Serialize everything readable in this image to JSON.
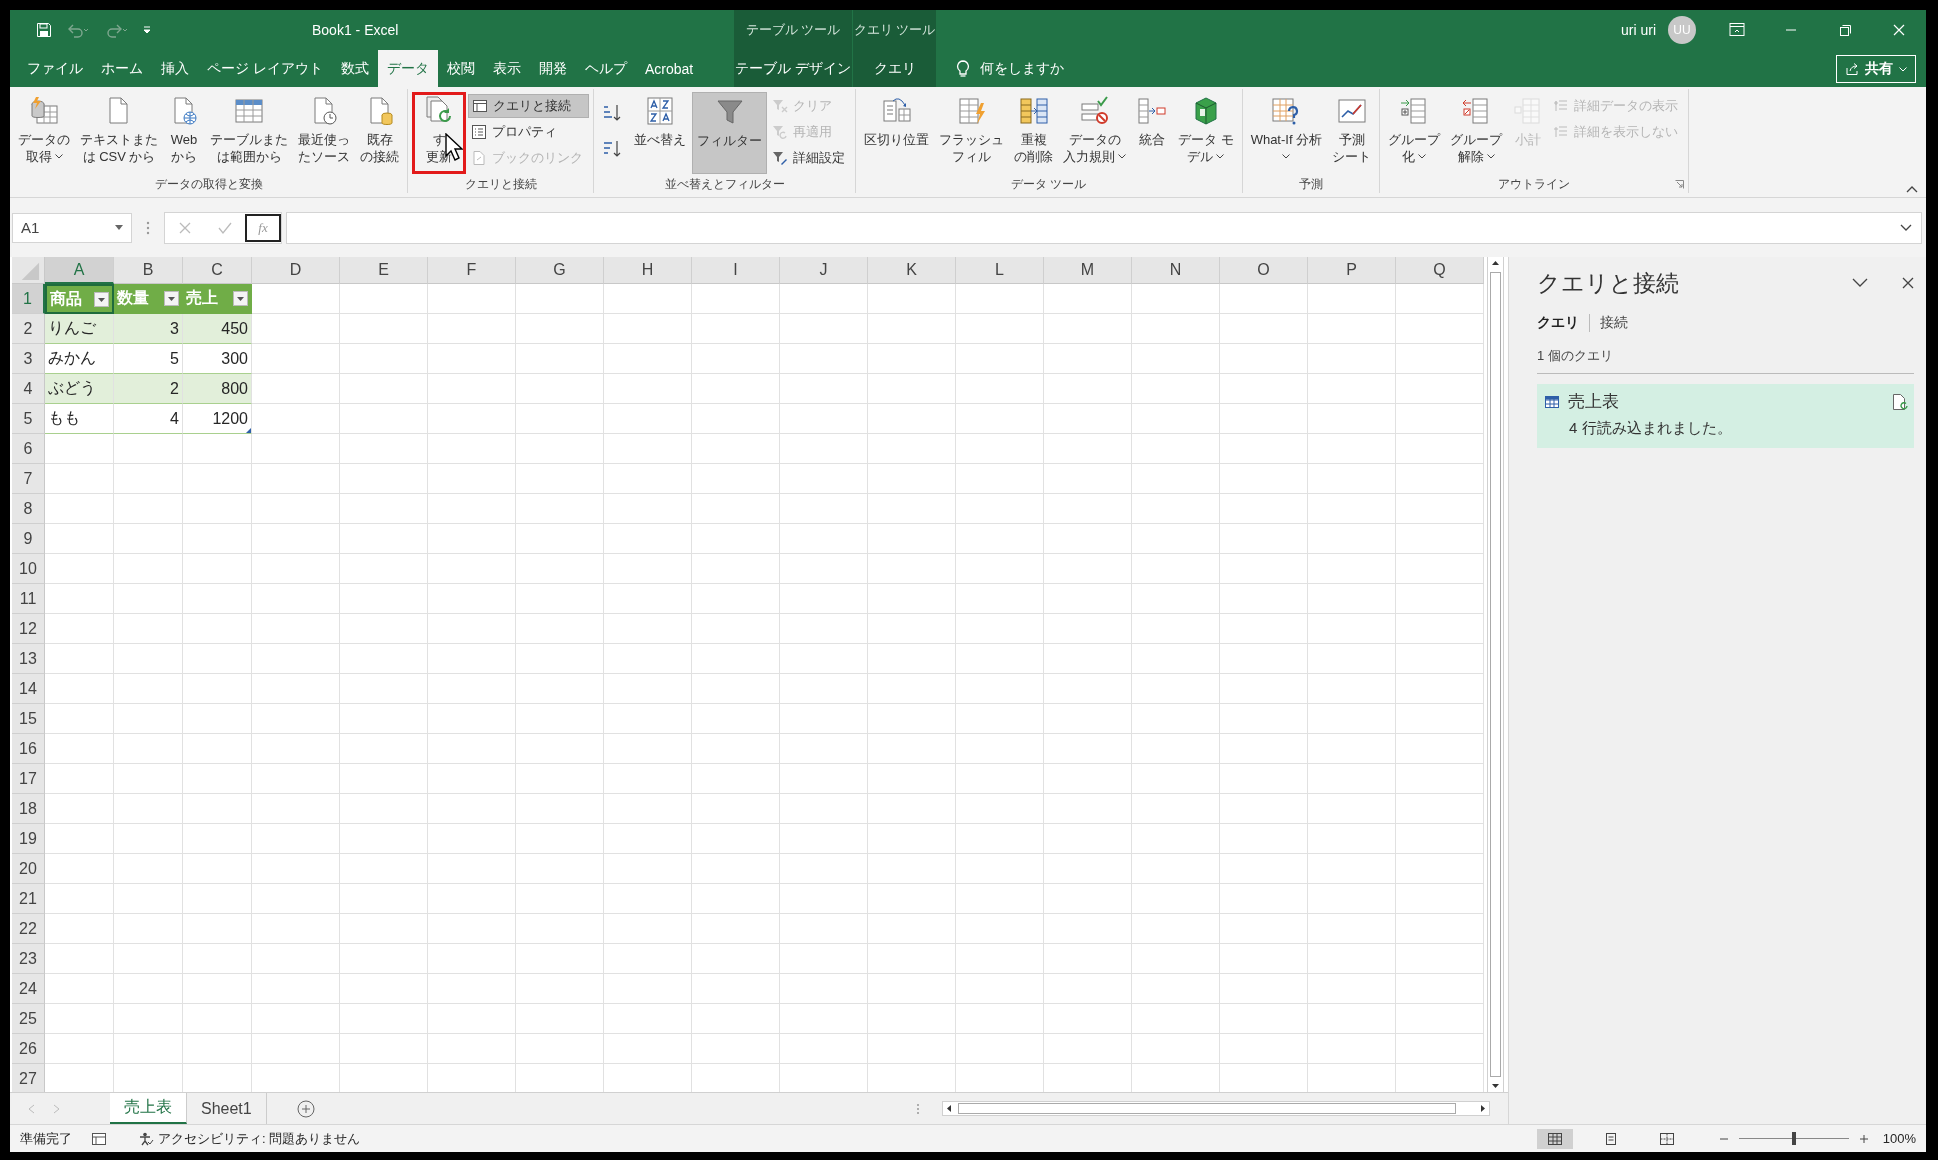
{
  "title_bar": {
    "title": "Book1  -  Excel",
    "context_labels": [
      "テーブル ツール",
      "クエリ ツール"
    ],
    "user": "uri uri",
    "avatar": "UU"
  },
  "ribbon_tabs": [
    {
      "label": "ファイル",
      "selected": false,
      "kind": "normal"
    },
    {
      "label": "ホーム",
      "selected": false,
      "kind": "normal"
    },
    {
      "label": "挿入",
      "selected": false,
      "kind": "normal"
    },
    {
      "label": "ページ レイアウト",
      "selected": false,
      "kind": "normal"
    },
    {
      "label": "数式",
      "selected": false,
      "kind": "normal"
    },
    {
      "label": "データ",
      "selected": true,
      "kind": "normal"
    },
    {
      "label": "校閲",
      "selected": false,
      "kind": "normal"
    },
    {
      "label": "表示",
      "selected": false,
      "kind": "normal"
    },
    {
      "label": "開発",
      "selected": false,
      "kind": "normal"
    },
    {
      "label": "ヘルプ",
      "selected": false,
      "kind": "normal"
    },
    {
      "label": "Acrobat",
      "selected": false,
      "kind": "normal"
    },
    {
      "label": "テーブル デザイン",
      "selected": false,
      "kind": "context"
    },
    {
      "label": "クエリ",
      "selected": false,
      "kind": "context"
    }
  ],
  "tell_me": "何をしますか",
  "share_button": "共有",
  "ribbon_groups": [
    {
      "label": "データの取得と変換",
      "items": [
        {
          "kind": "large",
          "lines": [
            "データの",
            "取得"
          ],
          "dropdown": true,
          "on": false,
          "disabled": false,
          "highlighted": false
        },
        {
          "kind": "large",
          "lines": [
            "テキストまた",
            "は CSV から"
          ],
          "dropdown": false,
          "on": false,
          "disabled": false,
          "highlighted": false
        },
        {
          "kind": "large",
          "lines": [
            "Web",
            "から"
          ],
          "dropdown": false,
          "on": false,
          "disabled": false,
          "highlighted": false
        },
        {
          "kind": "large",
          "lines": [
            "テーブルまた",
            "は範囲から"
          ],
          "dropdown": false,
          "on": false,
          "disabled": false,
          "highlighted": false
        },
        {
          "kind": "large",
          "lines": [
            "最近使っ",
            "たソース"
          ],
          "dropdown": false,
          "on": false,
          "disabled": false,
          "highlighted": false
        },
        {
          "kind": "large",
          "lines": [
            "既存",
            "の接続"
          ],
          "dropdown": false,
          "on": false,
          "disabled": false,
          "highlighted": false
        }
      ]
    },
    {
      "label": "クエリと接続",
      "items": [
        {
          "kind": "large",
          "lines": [
            "す",
            "更新"
          ],
          "dropdown": false,
          "on": false,
          "disabled": false,
          "highlighted": true
        },
        {
          "kind": "stack",
          "items": [
            {
              "label": "クエリと接続",
              "on": true,
              "disabled": false
            },
            {
              "label": "プロパティ",
              "on": false,
              "disabled": false
            },
            {
              "label": "ブックのリンク",
              "on": false,
              "disabled": true
            }
          ]
        }
      ]
    },
    {
      "label": "並べ替えとフィルター",
      "items": [
        {
          "kind": "sort_buttons"
        },
        {
          "kind": "large",
          "lines": [
            "並べ替え"
          ],
          "dropdown": false,
          "on": false,
          "disabled": false,
          "highlighted": false
        },
        {
          "kind": "large",
          "lines": [
            "フィルター"
          ],
          "dropdown": false,
          "on": true,
          "disabled": false,
          "highlighted": false
        },
        {
          "kind": "stack",
          "items": [
            {
              "label": "クリア",
              "on": false,
              "disabled": true
            },
            {
              "label": "再適用",
              "on": false,
              "disabled": true
            },
            {
              "label": "詳細設定",
              "on": false,
              "disabled": false
            }
          ]
        }
      ]
    },
    {
      "label": "データ ツール",
      "items": [
        {
          "kind": "large",
          "lines": [
            "区切り位置"
          ],
          "dropdown": false,
          "on": false,
          "disabled": false,
          "highlighted": false
        },
        {
          "kind": "large",
          "lines": [
            "フラッシュ",
            "フィル"
          ],
          "dropdown": false,
          "on": false,
          "disabled": false,
          "highlighted": false
        },
        {
          "kind": "large",
          "lines": [
            "重複",
            "の削除"
          ],
          "dropdown": false,
          "on": false,
          "disabled": false,
          "highlighted": false
        },
        {
          "kind": "large",
          "lines": [
            "データの",
            "入力規則"
          ],
          "dropdown": true,
          "on": false,
          "disabled": false,
          "highlighted": false
        },
        {
          "kind": "large",
          "lines": [
            "統合"
          ],
          "dropdown": false,
          "on": false,
          "disabled": false,
          "highlighted": false
        },
        {
          "kind": "large",
          "lines": [
            "データ モ",
            "デル"
          ],
          "dropdown": true,
          "on": false,
          "disabled": false,
          "highlighted": false
        }
      ]
    },
    {
      "label": "予測",
      "items": [
        {
          "kind": "large",
          "lines": [
            "What-If 分析"
          ],
          "dropdown": true,
          "caret_below": true,
          "on": false,
          "disabled": false,
          "highlighted": false
        },
        {
          "kind": "large",
          "lines": [
            "予測",
            "シート"
          ],
          "dropdown": false,
          "on": false,
          "disabled": false,
          "highlighted": false
        }
      ]
    },
    {
      "label": "アウトライン",
      "items": [
        {
          "kind": "large",
          "lines": [
            "グループ",
            "化"
          ],
          "dropdown": true,
          "on": false,
          "disabled": false,
          "highlighted": false
        },
        {
          "kind": "large",
          "lines": [
            "グループ",
            "解除"
          ],
          "dropdown": true,
          "on": false,
          "disabled": false,
          "highlighted": false
        },
        {
          "kind": "large",
          "lines": [
            "小計"
          ],
          "dropdown": false,
          "on": false,
          "disabled": true,
          "highlighted": false
        },
        {
          "kind": "stack",
          "items": [
            {
              "label": "詳細データの表示",
              "on": false,
              "disabled": true
            },
            {
              "label": "詳細を表示しない",
              "on": false,
              "disabled": true
            }
          ]
        }
      ]
    }
  ],
  "name_box": "A1",
  "function_button": "fx",
  "sheet": {
    "columns": [
      {
        "label": "A",
        "selected": true
      },
      {
        "label": "B",
        "selected": false
      },
      {
        "label": "C",
        "selected": false
      },
      {
        "label": "D",
        "selected": false
      },
      {
        "label": "E",
        "selected": false
      },
      {
        "label": "F",
        "selected": false
      },
      {
        "label": "G",
        "selected": false
      },
      {
        "label": "H",
        "selected": false
      },
      {
        "label": "I",
        "selected": false
      },
      {
        "label": "J",
        "selected": false
      },
      {
        "label": "K",
        "selected": false
      },
      {
        "label": "L",
        "selected": false
      },
      {
        "label": "M",
        "selected": false
      },
      {
        "label": "N",
        "selected": false
      },
      {
        "label": "O",
        "selected": false
      },
      {
        "label": "P",
        "selected": false
      },
      {
        "label": "Q",
        "selected": false
      }
    ],
    "rows": [
      {
        "label": "1",
        "selected": true
      },
      {
        "label": "2",
        "selected": false
      },
      {
        "label": "3",
        "selected": false
      },
      {
        "label": "4",
        "selected": false
      },
      {
        "label": "5",
        "selected": false
      },
      {
        "label": "6",
        "selected": false
      },
      {
        "label": "7",
        "selected": false
      },
      {
        "label": "8",
        "selected": false
      },
      {
        "label": "9",
        "selected": false
      },
      {
        "label": "10",
        "selected": false
      },
      {
        "label": "11",
        "selected": false
      },
      {
        "label": "12",
        "selected": false
      },
      {
        "label": "13",
        "selected": false
      },
      {
        "label": "14",
        "selected": false
      },
      {
        "label": "15",
        "selected": false
      },
      {
        "label": "16",
        "selected": false
      },
      {
        "label": "17",
        "selected": false
      },
      {
        "label": "18",
        "selected": false
      },
      {
        "label": "19",
        "selected": false
      },
      {
        "label": "20",
        "selected": false
      },
      {
        "label": "21",
        "selected": false
      },
      {
        "label": "22",
        "selected": false
      },
      {
        "label": "23",
        "selected": false
      },
      {
        "label": "24",
        "selected": false
      },
      {
        "label": "25",
        "selected": false
      },
      {
        "label": "26",
        "selected": false
      },
      {
        "label": "27",
        "selected": false
      }
    ],
    "table": {
      "columns": [
        {
          "header": "商品",
          "numeric": false
        },
        {
          "header": "数量",
          "numeric": true
        },
        {
          "header": "売上",
          "numeric": true
        }
      ],
      "rows": [
        [
          "りんご",
          "3",
          "450"
        ],
        [
          "みかん",
          "5",
          "300"
        ],
        [
          "ぶどう",
          "2",
          "800"
        ],
        [
          "もも",
          "4",
          "1200"
        ]
      ]
    }
  },
  "sheet_tabs": [
    {
      "label": "売上表",
      "selected": true
    },
    {
      "label": "Sheet1",
      "selected": false
    }
  ],
  "queries_panel": {
    "title": "クエリと接続",
    "tabs": [
      {
        "label": "クエリ",
        "selected": true
      },
      {
        "label": "接続",
        "selected": false
      }
    ],
    "count": "1 個のクエリ",
    "queries": [
      {
        "name": "売上表",
        "status": "4 行読み込まれました。",
        "selected": true
      }
    ]
  },
  "status_bar": {
    "ready": "準備完了",
    "accessibility": "アクセシビリティ: 問題ありません",
    "views": [
      {
        "kind": "normal",
        "selected": true
      },
      {
        "kind": "page_layout",
        "selected": false
      },
      {
        "kind": "page_break",
        "selected": false
      }
    ],
    "zoom": {
      "level": 0.5,
      "label": "100%"
    }
  }
}
